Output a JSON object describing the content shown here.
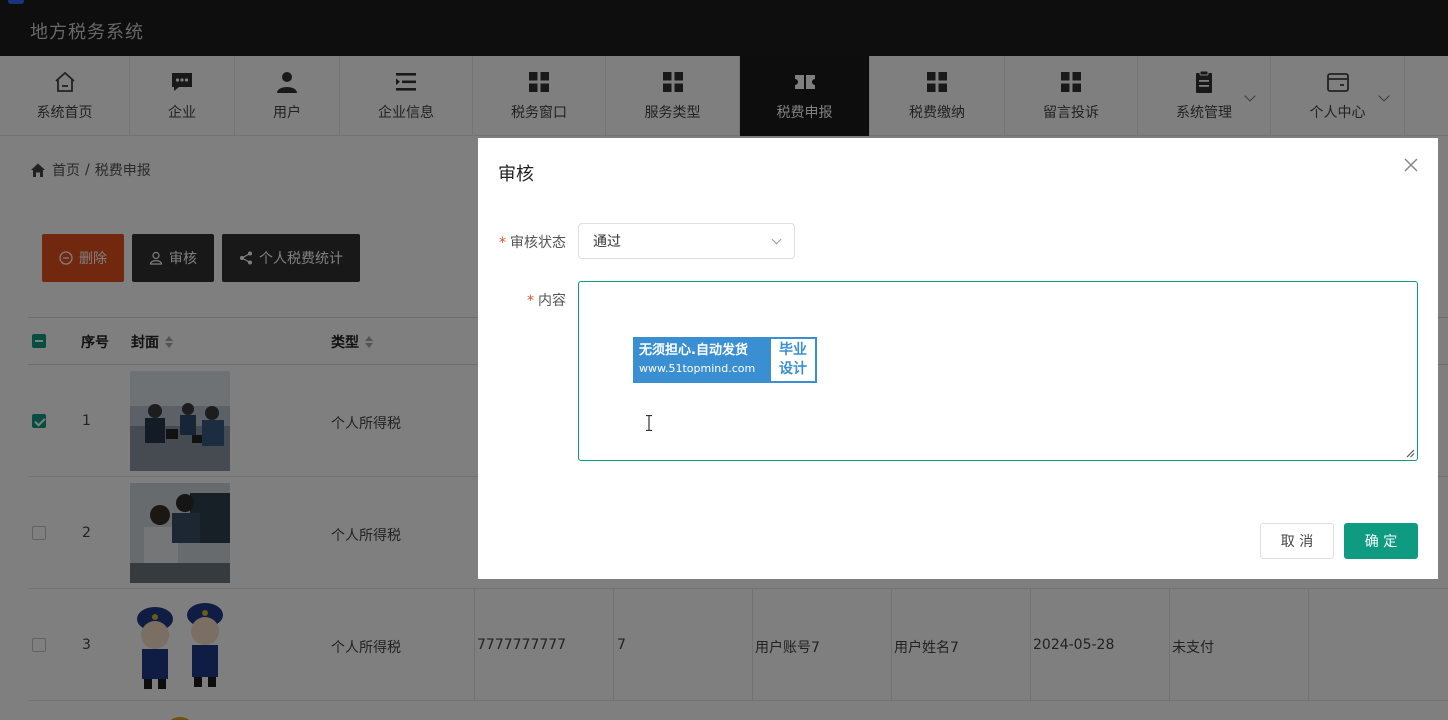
{
  "app": {
    "title": "地方税务系统"
  },
  "nav": [
    {
      "label": "系统首页",
      "icon": "home-icon"
    },
    {
      "label": "企业",
      "icon": "chat-icon"
    },
    {
      "label": "用户",
      "icon": "user-icon"
    },
    {
      "label": "企业信息",
      "icon": "list-icon"
    },
    {
      "label": "税务窗口",
      "icon": "grid-icon"
    },
    {
      "label": "服务类型",
      "icon": "grid-icon"
    },
    {
      "label": "税费申报",
      "icon": "ticket-icon",
      "active": true
    },
    {
      "label": "税费缴纳",
      "icon": "grid-icon"
    },
    {
      "label": "留言投诉",
      "icon": "grid-icon"
    },
    {
      "label": "系统管理",
      "icon": "clipboard-icon"
    },
    {
      "label": "个人中心",
      "icon": "wallet-icon"
    }
  ],
  "breadcrumb": {
    "home": "首页",
    "separator": "/",
    "current": "税费申报"
  },
  "toolbar": {
    "delete": "删除",
    "audit": "审核",
    "stats": "个人税费统计"
  },
  "table": {
    "headers": {
      "index": "序号",
      "cover": "封面",
      "type": "类型"
    },
    "rows": [
      {
        "index": "1",
        "type": "个人所得税",
        "checked": true
      },
      {
        "index": "2",
        "type": "个人所得税",
        "checked": false
      },
      {
        "index": "3",
        "type": "个人所得税",
        "checked": false,
        "code": "7777777777",
        "num": "7",
        "account": "用户账号7",
        "name": "用户姓名7",
        "date": "2024-05-28",
        "status": "未支付"
      }
    ]
  },
  "dialog": {
    "title": "审核",
    "status_label": "审核状态",
    "status_value": "通过",
    "content_label": "内容",
    "required_mark": "*",
    "cancel": "取 消",
    "confirm": "确 定"
  },
  "watermark": {
    "line1": "无须担心.自动发货",
    "line2": "www.51topmind.com",
    "tag1": "毕业",
    "tag2": "设计"
  },
  "colors": {
    "primary": "#0e9b82",
    "danger": "#e2501f",
    "dark": "#303133",
    "topbar": "#1d1d1d"
  }
}
